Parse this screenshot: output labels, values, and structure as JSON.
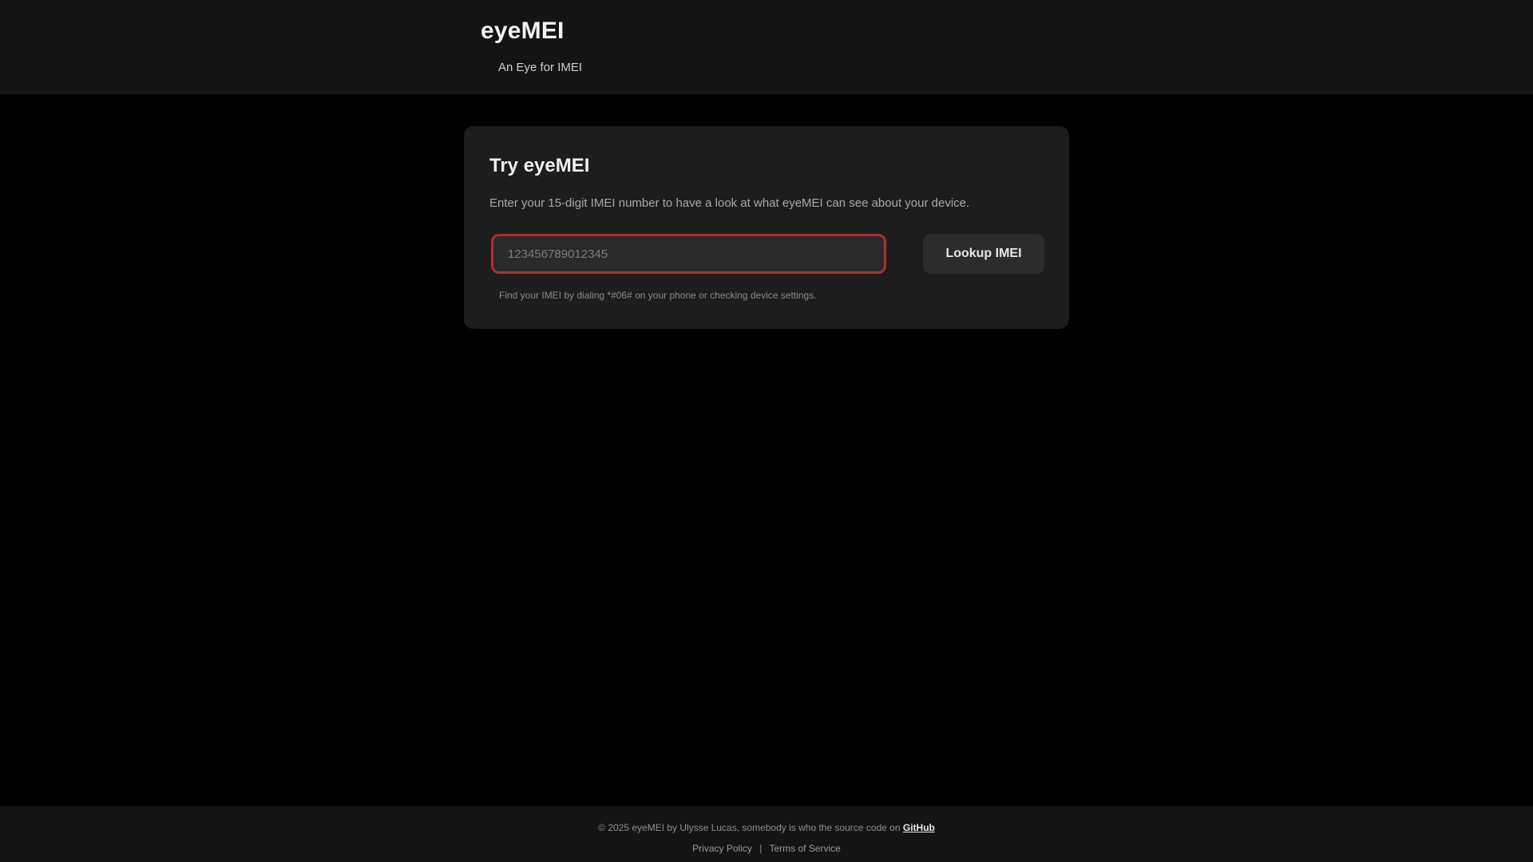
{
  "header": {
    "title": "eyeMEI",
    "tagline": "An Eye for IMEI"
  },
  "card": {
    "title": "Try eyeMEI",
    "description": "Enter your 15-digit IMEI number to have a look at what eyeMEI can see about your device.",
    "input": {
      "placeholder": "123456789012345",
      "value": ""
    },
    "button_label": "Lookup IMEI",
    "hint": "Find your IMEI by dialing *#06# on your phone or checking device settings."
  },
  "footer": {
    "copyright": "© 2025 eyeMEI by Ulysse Lucas, somebody is who the source code on",
    "copyright_link": "GitHub",
    "links": [
      "Privacy Policy",
      "Terms of Service"
    ],
    "separator": "|"
  },
  "colors": {
    "background": "#000000",
    "header_bg": "#141414",
    "card_bg": "#1d1d1d",
    "input_border_error": "#a83232"
  }
}
